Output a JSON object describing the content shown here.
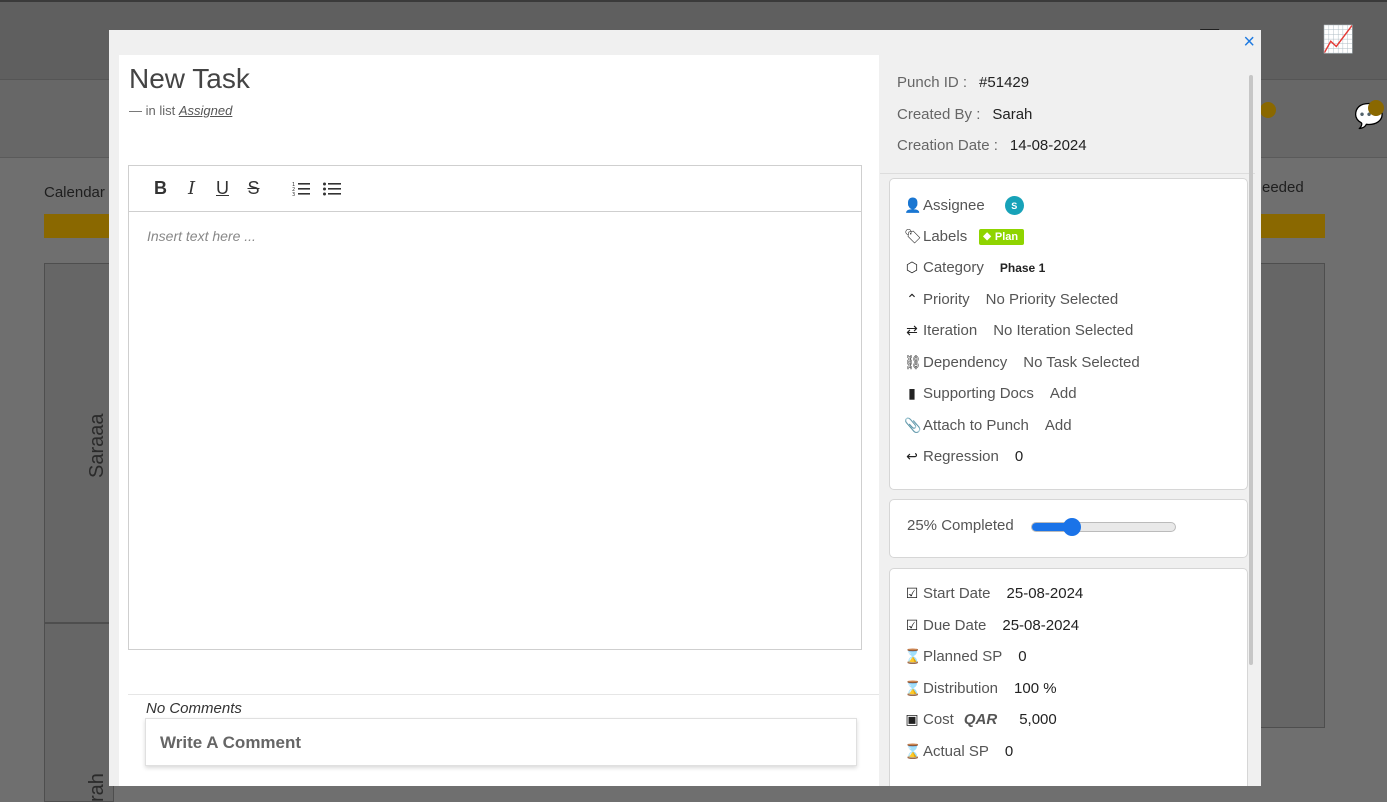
{
  "modal": {
    "title": "New Task",
    "in_list_prefix": "— in list",
    "in_list_link": "Assigned",
    "close_glyph": "×"
  },
  "editor": {
    "bold": "B",
    "italic": "I",
    "underline": "U",
    "strike": "S",
    "ordered_list": "ordered-list-icon",
    "bullet_list": "bullet-list-icon",
    "placeholder": "Insert text here ..."
  },
  "comments": {
    "empty_text": "No Comments",
    "input_placeholder": "Write A Comment"
  },
  "meta": {
    "punch_id_label": "Punch ID :",
    "punch_id_value": "#51429",
    "created_by_label": "Created By :",
    "created_by_value": "Sarah",
    "creation_date_label": "Creation Date :",
    "creation_date_value": "14-08-2024"
  },
  "properties": {
    "assignee_label": "Assignee",
    "assignee_initial": "S",
    "labels_label": "Labels",
    "label_chip": "Plan",
    "category_label": "Category",
    "category_value": "Phase 1",
    "priority_label": "Priority",
    "priority_value": "No Priority Selected",
    "iteration_label": "Iteration",
    "iteration_value": "No Iteration Selected",
    "dependency_label": "Dependency",
    "dependency_value": "No Task Selected",
    "supporting_docs_label": "Supporting Docs",
    "supporting_docs_value": "Add",
    "attach_label": "Attach to Punch",
    "attach_value": "Add",
    "regression_label": "Regression",
    "regression_value": "0"
  },
  "progress": {
    "label": "25% Completed",
    "fraction": 0.28
  },
  "schedule": {
    "start_label": "Start Date",
    "start_value": "25-08-2024",
    "due_label": "Due Date",
    "due_value": "25-08-2024",
    "planned_label": "Planned SP",
    "planned_value": "0",
    "distribution_label": "Distribution",
    "distribution_value": "100 %",
    "cost_label": "Cost",
    "cost_currency": "QAR",
    "cost_value": "5,000",
    "actual_label": "Actual SP",
    "actual_value": "0"
  },
  "background": {
    "calendar_label": "Calendar",
    "needed_label": "eeded",
    "vertical_name_1": "Saraaa",
    "vertical_name_2": "rah"
  },
  "colors": {
    "accent": "#1a73e8",
    "label_chip": "#8fd400",
    "avatar": "#17a2b8",
    "overlay_bar": "#8a6800"
  }
}
